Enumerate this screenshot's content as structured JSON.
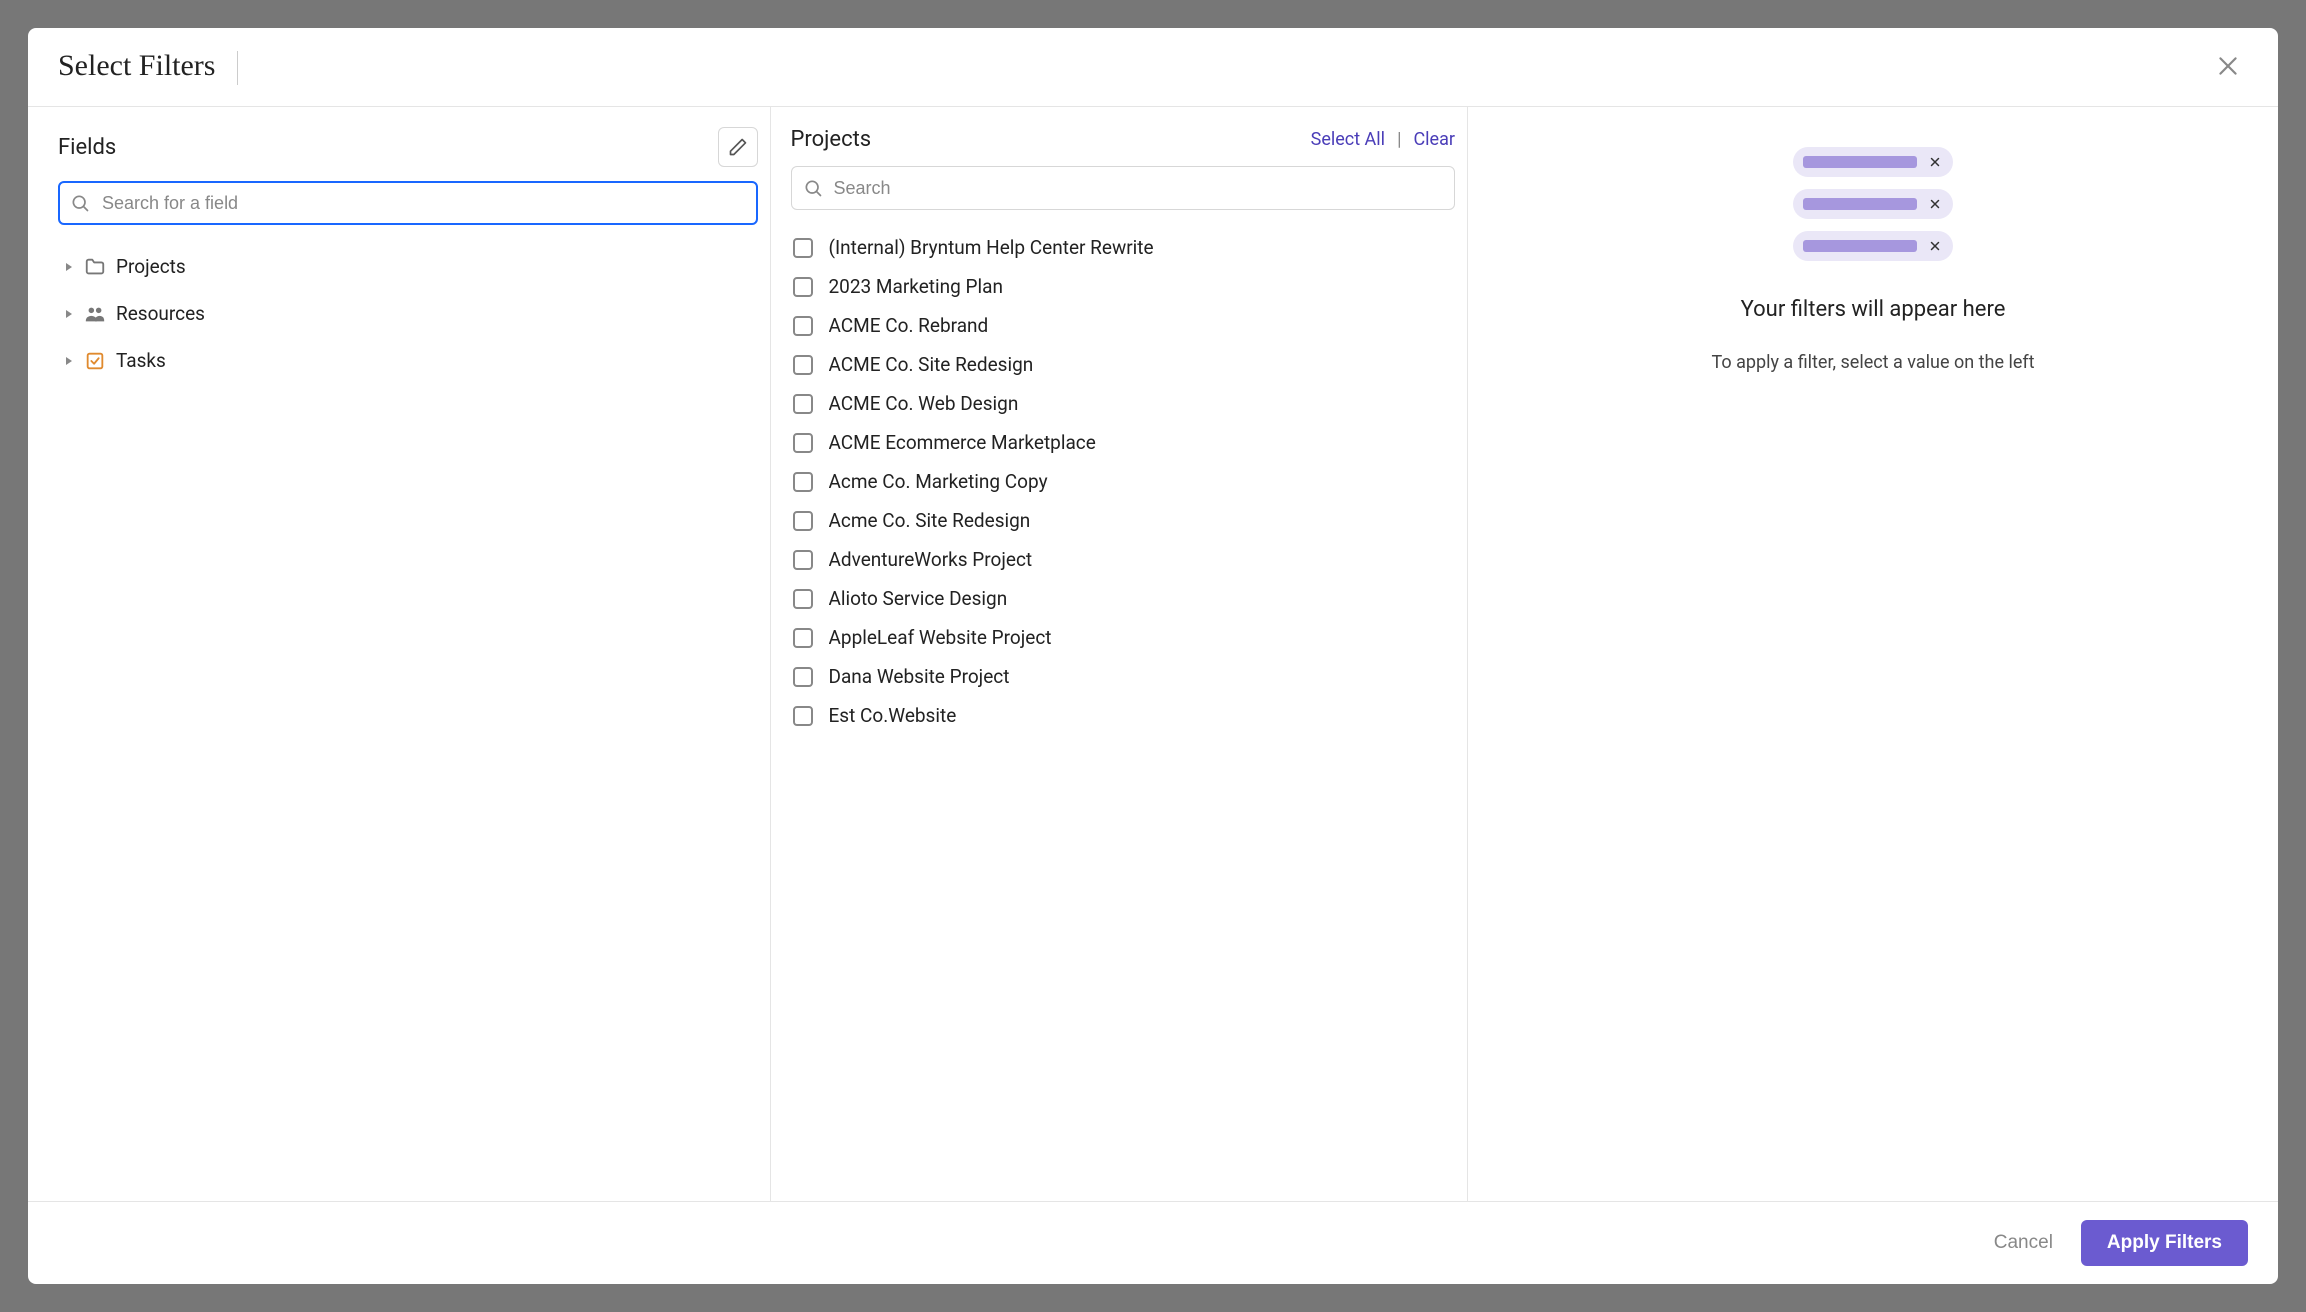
{
  "header": {
    "title": "Select Filters"
  },
  "fields_panel": {
    "heading": "Fields",
    "search_placeholder": "Search for a field",
    "tree": [
      {
        "icon": "folder",
        "label": "Projects"
      },
      {
        "icon": "people",
        "label": "Resources"
      },
      {
        "icon": "task",
        "label": "Tasks"
      }
    ]
  },
  "values_panel": {
    "heading": "Projects",
    "select_all": "Select All",
    "clear": "Clear",
    "search_placeholder": "Search",
    "items": [
      "(Internal) Bryntum Help Center Rewrite",
      "2023 Marketing Plan",
      "ACME Co. Rebrand",
      "ACME Co. Site Redesign",
      "ACME Co. Web Design",
      "ACME Ecommerce Marketplace",
      "Acme Co. Marketing Copy",
      "Acme Co. Site Redesign",
      "AdventureWorks Project",
      "Alioto Service Design",
      "AppleLeaf Website Project",
      "Dana Website Project",
      "Est Co.Website"
    ]
  },
  "preview_panel": {
    "title": "Your filters will appear here",
    "subtitle": "To apply a filter, select a value on the left"
  },
  "footer": {
    "cancel": "Cancel",
    "apply": "Apply Filters"
  }
}
